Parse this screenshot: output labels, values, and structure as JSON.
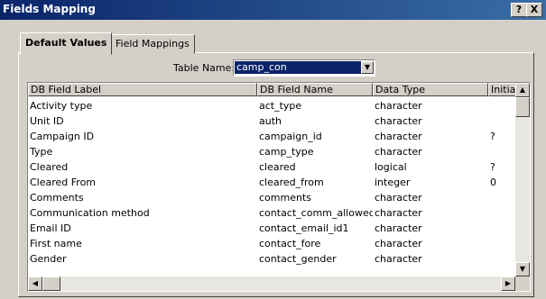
{
  "window": {
    "title": "Fields Mapping",
    "help": "?",
    "close": "X"
  },
  "tabs": [
    {
      "label": "Default Values"
    },
    {
      "label": "Field Mappings"
    }
  ],
  "table_name": {
    "label": "Table Name:",
    "value": "camp_con"
  },
  "grid": {
    "columns": [
      "DB Field Label",
      "DB Field Name",
      "Data Type",
      "Initial"
    ],
    "rows": [
      [
        "Activity type",
        "act_type",
        "character",
        ""
      ],
      [
        "Unit ID",
        "auth",
        "character",
        ""
      ],
      [
        "Campaign ID",
        "campaign_id",
        "character",
        "?"
      ],
      [
        "Type",
        "camp_type",
        "character",
        ""
      ],
      [
        "Cleared",
        "cleared",
        "logical",
        "?"
      ],
      [
        "Cleared From",
        "cleared_from",
        "integer",
        "0"
      ],
      [
        "Comments",
        "comments",
        "character",
        ""
      ],
      [
        "Communication method",
        "contact_comm_allowed",
        "character",
        ""
      ],
      [
        "Email ID",
        "contact_email_id1",
        "character",
        ""
      ],
      [
        "First name",
        "contact_fore",
        "character",
        ""
      ],
      [
        "Gender",
        "contact_gender",
        "character",
        ""
      ]
    ]
  },
  "icons": {
    "dropdown": "chevron-down-icon",
    "scroll_up": "arrow-up-icon",
    "scroll_down": "arrow-down-icon",
    "scroll_left": "arrow-left-icon",
    "scroll_right": "arrow-right-icon"
  }
}
